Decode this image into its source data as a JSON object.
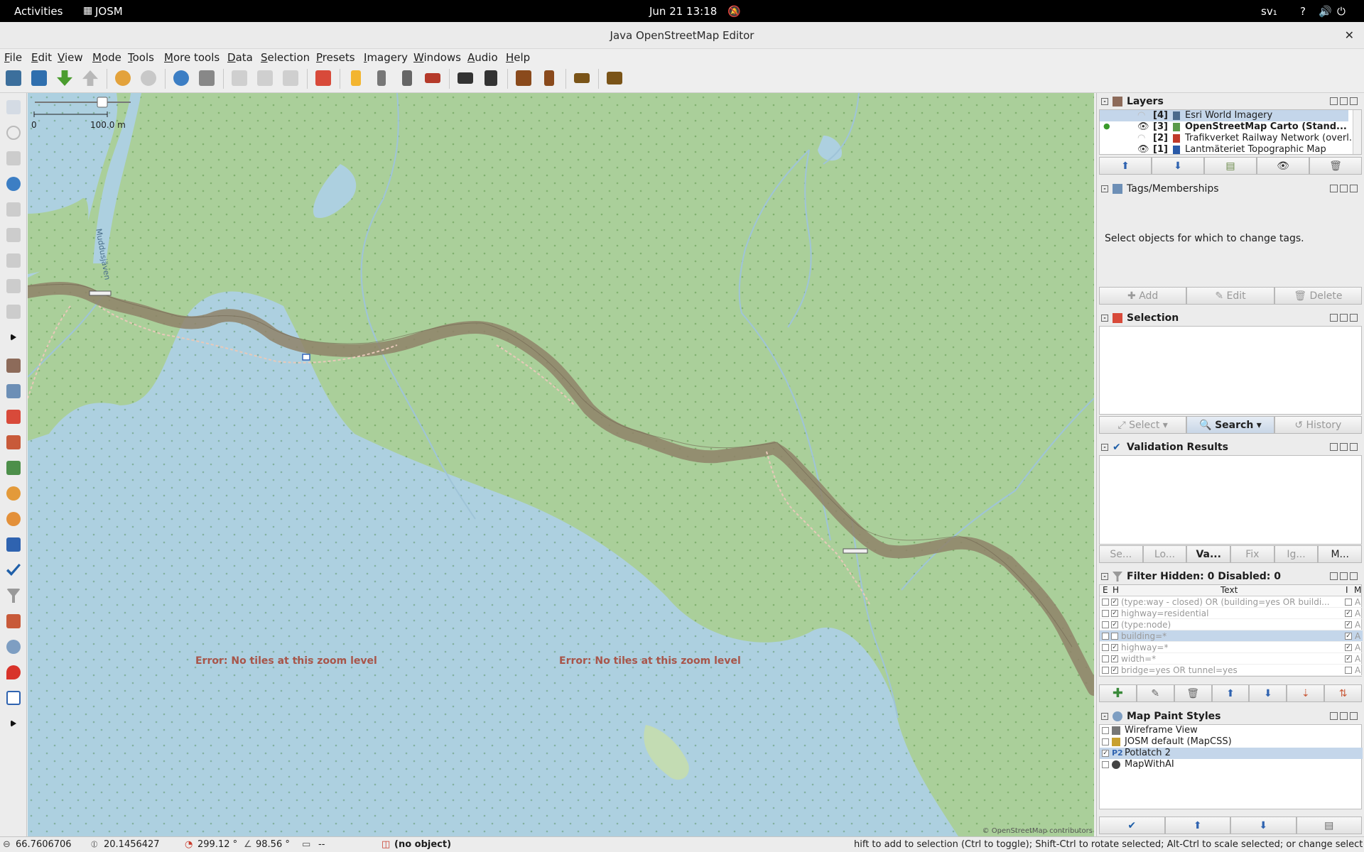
{
  "system": {
    "activities": "Activities",
    "app": "JOSM",
    "datetime": "Jun 21  13:18",
    "locale": "sv₁"
  },
  "window": {
    "title": "Java OpenStreetMap Editor",
    "close": "✕"
  },
  "menu": [
    "File",
    "Edit",
    "View",
    "Mode",
    "Tools",
    "More tools",
    "Data",
    "Selection",
    "Presets",
    "Imagery",
    "Windows",
    "Audio",
    "Help"
  ],
  "toolbar_icons": [
    "open-icon",
    "save-icon",
    "download-icon",
    "upload-icon",
    "undo-icon",
    "redo-icon",
    "zoom-icon",
    "preferences-icon",
    "align-icon",
    "distribute-icon",
    "split-icon",
    "reverse-icon",
    "road-preset-icon",
    "railway-preset-icon",
    "crossing-preset-icon",
    "barrier-preset-icon",
    "car-preset-icon",
    "bus-preset-icon",
    "hazard-preset-icon",
    "food-preset-icon",
    "castle-preset-icon",
    "industry-preset-icon"
  ],
  "map": {
    "scale_zero": "0",
    "scale_label": "100.0 m",
    "error1": "Error: No tiles at this zoom level",
    "error2": "Error: No tiles at this zoom level",
    "river_label": "Muddusjäven",
    "attribution": "© OpenStreetMap contributors",
    "colors": {
      "land": "#aacf9a",
      "water": "#add0e0",
      "river": "#8f8268"
    }
  },
  "layers": {
    "title": "Layers",
    "items": [
      {
        "num": "[4]",
        "name": "Esri World Imagery",
        "visible": false,
        "selected": true
      },
      {
        "num": "[3]",
        "name": "OpenStreetMap Carto (Stand...",
        "visible": true,
        "active": true
      },
      {
        "num": "[2]",
        "name": "Trafikverket Railway Network (overl...",
        "visible": false
      },
      {
        "num": "[1]",
        "name": "Lantmäteriet Topographic Map",
        "visible": true
      }
    ]
  },
  "tags": {
    "title": "Tags/Memberships",
    "message": "Select objects for which to change tags.",
    "add": "Add",
    "edit": "Edit",
    "delete": "Delete"
  },
  "selection": {
    "title": "Selection",
    "select": "Select",
    "search": "Search",
    "history": "History"
  },
  "validation": {
    "title": "Validation Results",
    "buttons": [
      "Se...",
      "Lo...",
      "Va...",
      "Fix",
      "Ig...",
      "M..."
    ]
  },
  "filter": {
    "title": "Filter Hidden: 0 Disabled: 0",
    "col_e": "E",
    "col_h": "H",
    "col_text": "Text",
    "col_i": "I",
    "col_m": "M",
    "rows": [
      {
        "text": "(type:way - closed)  OR (building=yes OR buildi...",
        "h": true,
        "i": false,
        "m": "A"
      },
      {
        "text": "highway=residential",
        "h": true,
        "i": true,
        "m": "A"
      },
      {
        "text": "(type:node)",
        "h": true,
        "i": true,
        "m": "A"
      },
      {
        "text": "building=*",
        "h": false,
        "i": true,
        "m": "A",
        "selected": true
      },
      {
        "text": "highway=*",
        "h": true,
        "i": true,
        "m": "A"
      },
      {
        "text": "width=*",
        "h": true,
        "i": true,
        "m": "A"
      },
      {
        "text": "bridge=yes OR tunnel=yes",
        "h": true,
        "i": false,
        "m": "A"
      }
    ]
  },
  "mapstyles": {
    "title": "Map Paint Styles",
    "items": [
      {
        "name": "Wireframe View",
        "checked": false
      },
      {
        "name": "JOSM default (MapCSS)",
        "checked": false
      },
      {
        "name": "Potlatch 2",
        "checked": true,
        "selected": true
      },
      {
        "name": "MapWithAI",
        "checked": false
      }
    ]
  },
  "status": {
    "lat": "66.7606706",
    "lon": "20.1456427",
    "heading": "299.12 °",
    "angle": "98.56 °",
    "length": "--",
    "object": "(no object)",
    "hint": "hift to add to selection (Ctrl to toggle); Shift-Ctrl to rotate selected; Alt-Ctrl to scale selected; or change selection"
  }
}
